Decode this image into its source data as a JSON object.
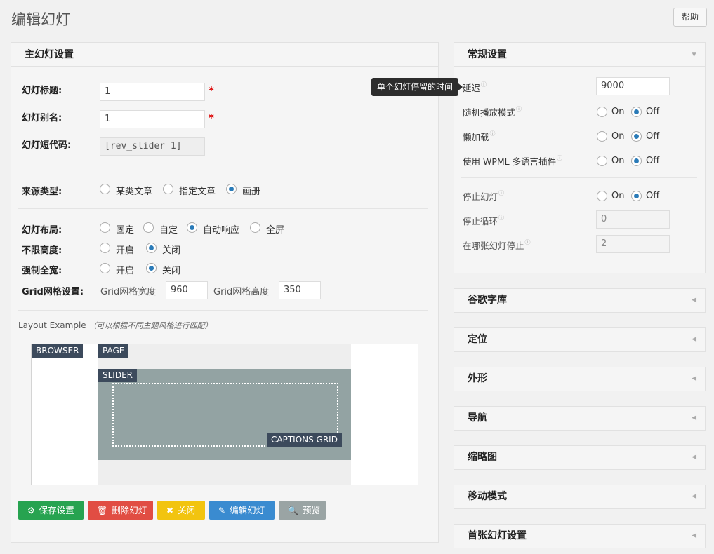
{
  "header": {
    "title": "编辑幻灯",
    "help_label": "帮助"
  },
  "main_panel": {
    "title": "主幻灯设置",
    "slider_title_label": "幻灯标题:",
    "slider_title_value": "1",
    "slider_alias_label": "幻灯别名:",
    "slider_alias_value": "1",
    "required_mark": "*",
    "shortcode_label": "幻灯短代码:",
    "shortcode_value": "[rev_slider 1]",
    "source_label": "来源类型:",
    "source_options": [
      "某类文章",
      "指定文章",
      "画册"
    ],
    "layout_label": "幻灯布局:",
    "layout_options": [
      "固定",
      "自定",
      "自动响应",
      "全屏"
    ],
    "unlimited_height_label": "不限高度:",
    "force_fullwidth_label": "强制全宽:",
    "on_label": "开启",
    "off_label": "关闭",
    "grid_label": "Grid网格设置:",
    "grid_width_label": "Grid网格宽度",
    "grid_width_value": "960",
    "grid_height_label": "Grid网格高度",
    "grid_height_value": "350",
    "layout_example_label": "Layout Example",
    "layout_example_note": "（可以根据不同主题风格进行匹配）",
    "tags": {
      "browser": "BROWSER",
      "page": "PAGE",
      "slider": "SLIDER",
      "captions": "CAPTIONS GRID"
    }
  },
  "buttons": {
    "save": "保存设置",
    "delete": "删除幻灯",
    "close": "关闭",
    "edit": "编辑幻灯",
    "preview": "预览"
  },
  "general_panel": {
    "title": "常规设置",
    "tooltip": "单个幻灯停留的时间",
    "delay_label": "延迟",
    "delay_value": "9000",
    "shuffle_label": "随机播放模式",
    "lazy_label": "懒加载",
    "wpml_label": "使用 WPML 多语言插件",
    "stop_slider_label": "停止幻灯",
    "stop_loop_label": "停止循环",
    "stop_loop_value": "0",
    "stop_at_label": "在哪张幻灯停止",
    "stop_at_value": "2",
    "on": "On",
    "off": "Off",
    "info_icon": "ⓘ"
  },
  "accordions": [
    "谷歌字库",
    "定位",
    "外形",
    "导航",
    "缩略图",
    "移动模式",
    "首张幻灯设置"
  ],
  "colors": {
    "save": "#27a350",
    "delete": "#e14d43",
    "close": "#f2c40f",
    "edit": "#3a8bd0",
    "preview": "#9aa4a4",
    "tag": "#3c4a5c",
    "slider": "#93a3a3"
  }
}
